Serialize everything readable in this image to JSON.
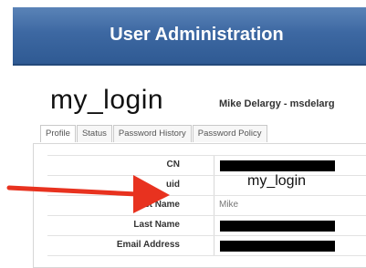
{
  "header": {
    "title": "User Administration"
  },
  "page": {
    "big_title": "my_login",
    "user_line": "Mike Delargy - msdelarg"
  },
  "tabs": [
    {
      "label": "Profile"
    },
    {
      "label": "Status"
    },
    {
      "label": "Password History"
    },
    {
      "label": "Password Policy"
    }
  ],
  "fields": [
    {
      "label": "CN",
      "value": ""
    },
    {
      "label": "uid",
      "value": ""
    },
    {
      "label": "First Name",
      "value": "Mike"
    },
    {
      "label": "Last Name",
      "value": ""
    },
    {
      "label": "Email Address",
      "value": ""
    }
  ],
  "annotation": {
    "text": "my_login",
    "arrow_color": "#e8321f"
  },
  "colors": {
    "header": "#3d68a2",
    "header_text": "#ffffff",
    "redaction": "#000000"
  }
}
